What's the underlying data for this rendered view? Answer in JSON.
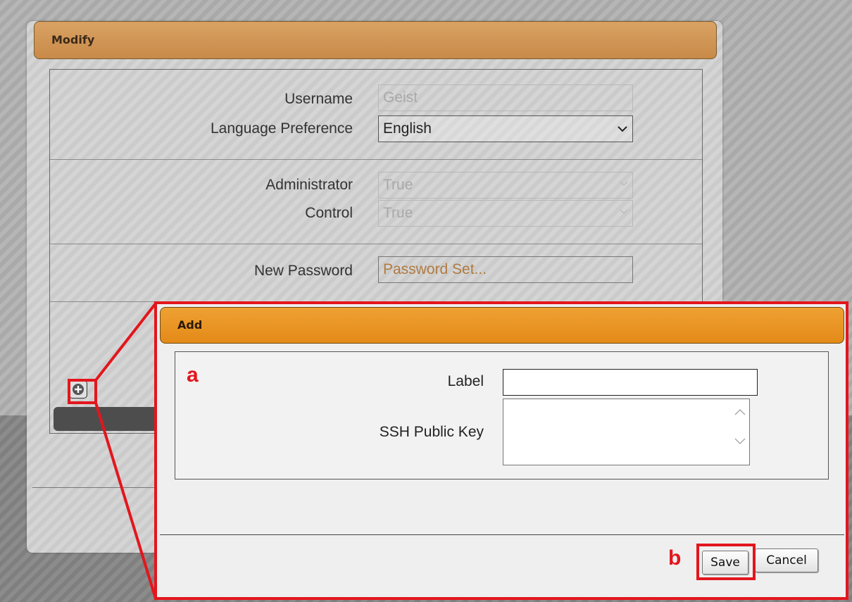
{
  "colors": {
    "modify_header": "#c88a48",
    "add_header": "#e48a18",
    "highlight": "#e3161d",
    "password_text": "#b07a40"
  },
  "modify_dialog": {
    "title": "Modify",
    "fields": {
      "username_label": "Username",
      "username_value": "Geist",
      "language_label": "Language Preference",
      "language_value": "English",
      "administrator_label": "Administrator",
      "administrator_value": "True",
      "control_label": "Control",
      "control_value": "True",
      "new_password_label": "New Password",
      "new_password_value": "Password Set..."
    },
    "add_key_icon": "plus-circle-icon"
  },
  "add_dialog": {
    "title": "Add",
    "marker_a": "a",
    "marker_b": "b",
    "label_field_label": "Label",
    "label_field_value": "",
    "ssh_key_label": "SSH Public Key",
    "ssh_key_value": "",
    "save_label": "Save",
    "cancel_label": "Cancel"
  }
}
